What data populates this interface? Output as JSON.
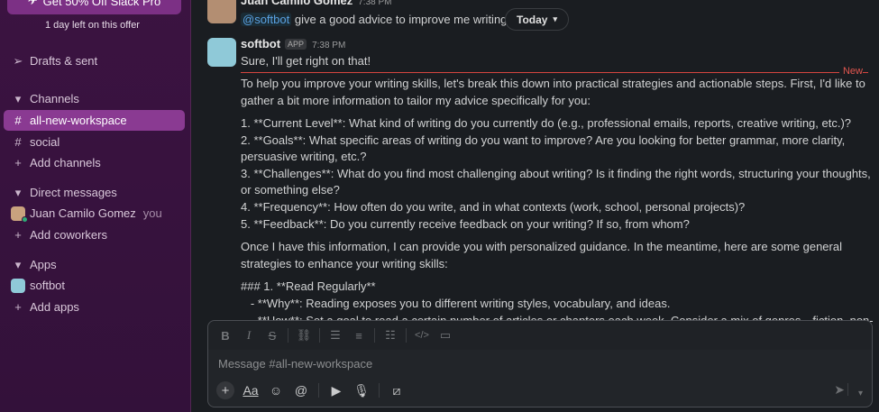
{
  "sidebar": {
    "promo_label": "Get 50% Off Slack Pro",
    "promo_sub": "1 day left on this offer",
    "drafts": "Drafts & sent",
    "channels_header": "Channels",
    "channels": [
      {
        "name": "all-new-workspace",
        "active": true
      },
      {
        "name": "social",
        "active": false
      }
    ],
    "add_channels": "Add channels",
    "dm_header": "Direct messages",
    "dm_user": "Juan Camilo Gomez",
    "dm_you": "you",
    "add_coworkers": "Add coworkers",
    "apps_header": "Apps",
    "app_name": "softbot",
    "add_apps": "Add apps"
  },
  "messages": {
    "first": {
      "author": "Juan Camilo Gomez",
      "time": "7:38 PM",
      "mention": "@softbot",
      "text": " give a good advice to improve me writing s"
    },
    "today_label": "Today",
    "bot": {
      "author": "softbot",
      "badge": "APP",
      "time": "7:38 PM",
      "reply": "Sure, I'll get right on that!"
    },
    "new_label": "New",
    "lines": [
      "To help you improve your writing skills, let's break this down into practical strategies and actionable steps. First, I'd like to",
      "gather a bit more information to tailor my advice specifically for you:",
      "1. **Current Level**: What kind of writing do you currently do (e.g., professional emails, reports, creative writing, etc.)?",
      "2. **Goals**: What specific areas of writing do you want to improve? Are you looking for better grammar, more clarity,",
      "persuasive writing, etc.?",
      "3. **Challenges**: What do you find most challenging about writing? Is it finding the right words, structuring your thoughts,",
      "or something else?",
      "4. **Frequency**: How often do you write, and in what contexts (work, school, personal projects)?",
      "5. **Feedback**: Do you currently receive feedback on your writing? If so, from whom?",
      "Once I have this information, I can provide you with personalized guidance. In the meantime, here are some general",
      "strategies to enhance your writing skills:",
      "### 1. **Read Regularly**",
      "   - **Why**: Reading exposes you to different writing styles, vocabulary, and ideas.",
      "   - **How**: Set a goal to read a certain number of articles or chapters each week. Consider a mix of genres—fiction, non-"
    ]
  },
  "composer": {
    "placeholder": "Message #all-new-workspace",
    "format_icons": [
      "bold-icon",
      "italic-icon",
      "strikethrough-icon",
      "link-icon",
      "ordered-list-icon",
      "bullet-list-icon",
      "numbered-block-icon",
      "code-icon",
      "code-block-icon"
    ],
    "action_icons": [
      "plus-icon",
      "text-format-icon",
      "emoji-icon",
      "mention-icon",
      "video-icon",
      "microphone-icon",
      "slash-command-icon"
    ]
  },
  "colors": {
    "sidebar_bg": "#3b1341",
    "active_item": "#8a3a92",
    "new_divider": "#d5453f",
    "mention": "#5aa2e3"
  }
}
